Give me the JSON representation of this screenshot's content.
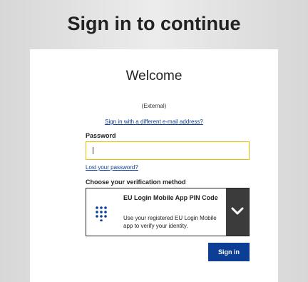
{
  "page": {
    "title": "Sign in to continue"
  },
  "card": {
    "welcome": "Welcome",
    "external": "(External)",
    "different_email_link": "Sign in with a different e-mail address?",
    "password_label": "Password",
    "password_value": "",
    "lost_password_link": "Lost your password?",
    "choose_method_label": "Choose your verification method",
    "method": {
      "icon": "keypad-icon",
      "title": "EU Login Mobile App PIN Code",
      "description": "Use your registered EU Login Mobile app to verify your identity."
    },
    "sign_in_button": "Sign in"
  },
  "colors": {
    "accent": "#0b3e94",
    "focus_border": "#e3c200",
    "dropdown_bg": "#3b3b3b"
  }
}
